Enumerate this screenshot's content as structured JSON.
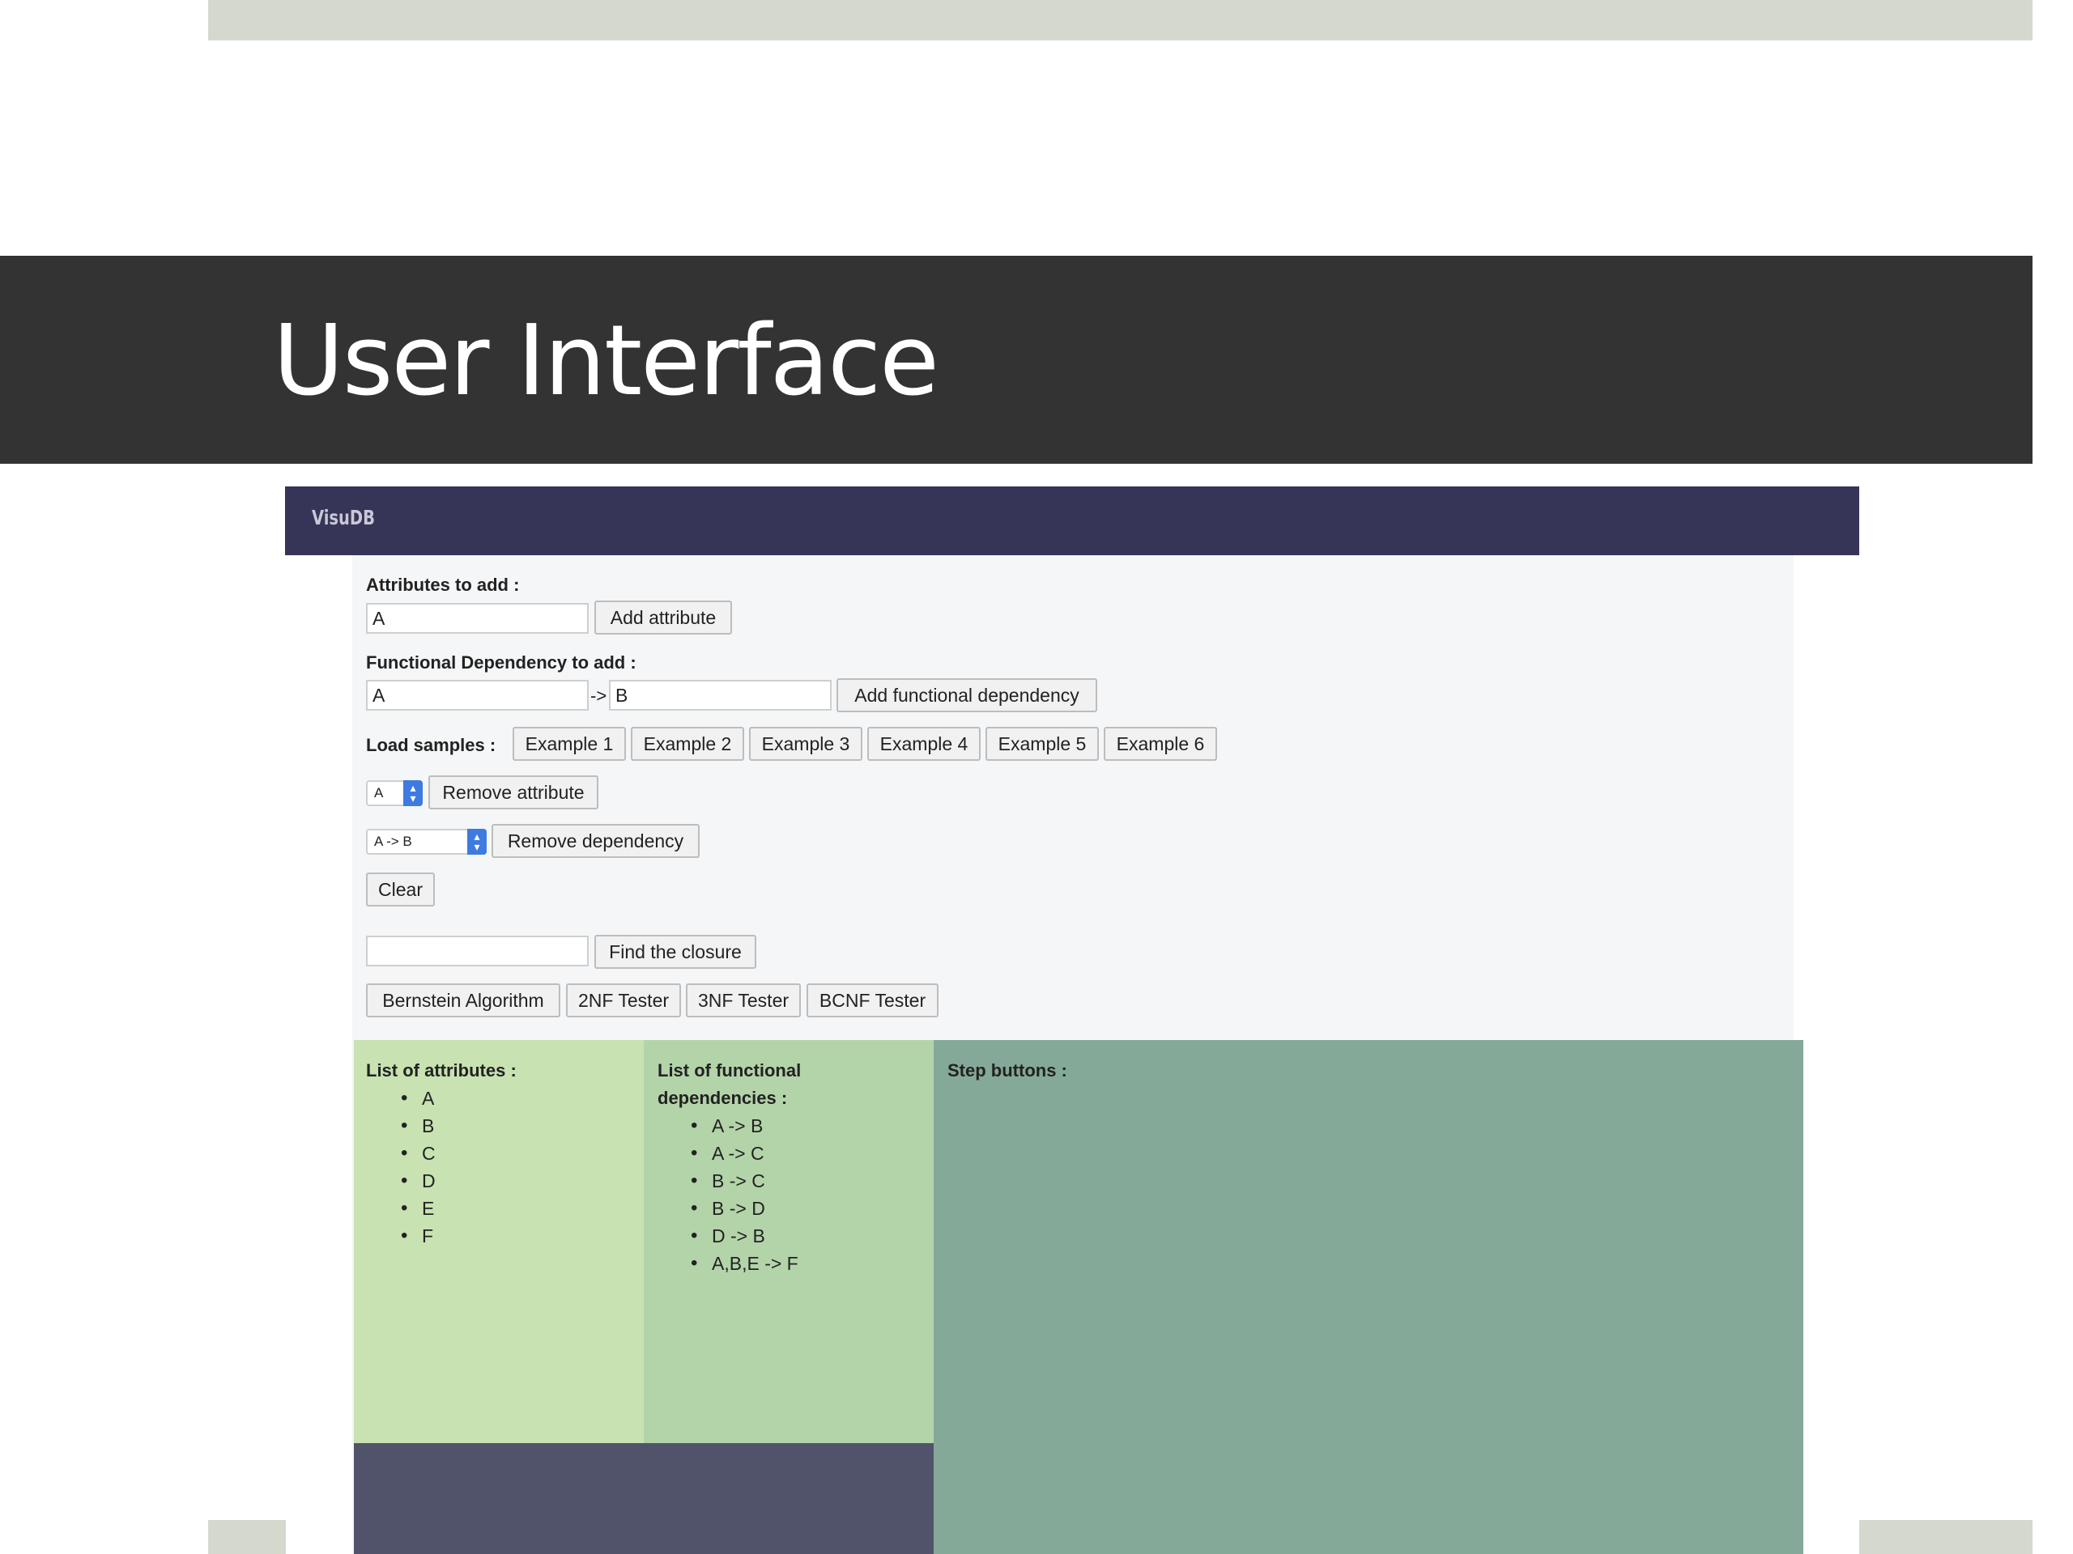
{
  "slide": {
    "title": "User Interface"
  },
  "app": {
    "brand": "VisuDB",
    "attributes_section": {
      "label": "Attributes to add :",
      "input_value": "A",
      "add_button": "Add attribute"
    },
    "fd_section": {
      "label": "Functional Dependency to add :",
      "left_value": "A",
      "arrow": "->",
      "right_value": "B",
      "add_button": "Add functional dependency"
    },
    "samples": {
      "label": "Load samples :",
      "buttons": [
        "Example 1",
        "Example 2",
        "Example 3",
        "Example 4",
        "Example 5",
        "Example 6"
      ]
    },
    "remove_attribute": {
      "selected": "A",
      "button": "Remove attribute"
    },
    "remove_dependency": {
      "selected": "A -> B",
      "button": "Remove dependency"
    },
    "clear_button": "Clear",
    "closure": {
      "input_value": "",
      "button": "Find the closure"
    },
    "algorithms": [
      "Bernstein Algorithm",
      "2NF Tester",
      "3NF Tester",
      "BCNF Tester"
    ],
    "attributes_list": {
      "title": "List of attributes :",
      "items": [
        "A",
        "B",
        "C",
        "D",
        "E",
        "F"
      ]
    },
    "fd_list": {
      "title_line1": "List of functional",
      "title_line2": "dependencies :",
      "items": [
        "A -> B",
        "A -> C",
        "B -> C",
        "B -> D",
        "D -> B",
        "A,B,E -> F"
      ]
    },
    "steps": {
      "title": "Step buttons :"
    }
  },
  "colors": {
    "title_bar": "#333333",
    "app_header": "#363457",
    "attributes_panel": "#c8e2b1",
    "fd_panel": "#b3d4a9",
    "steps_panel": "#85a998",
    "footer": "#51536b",
    "accent_strip": "#d5d9cd"
  }
}
